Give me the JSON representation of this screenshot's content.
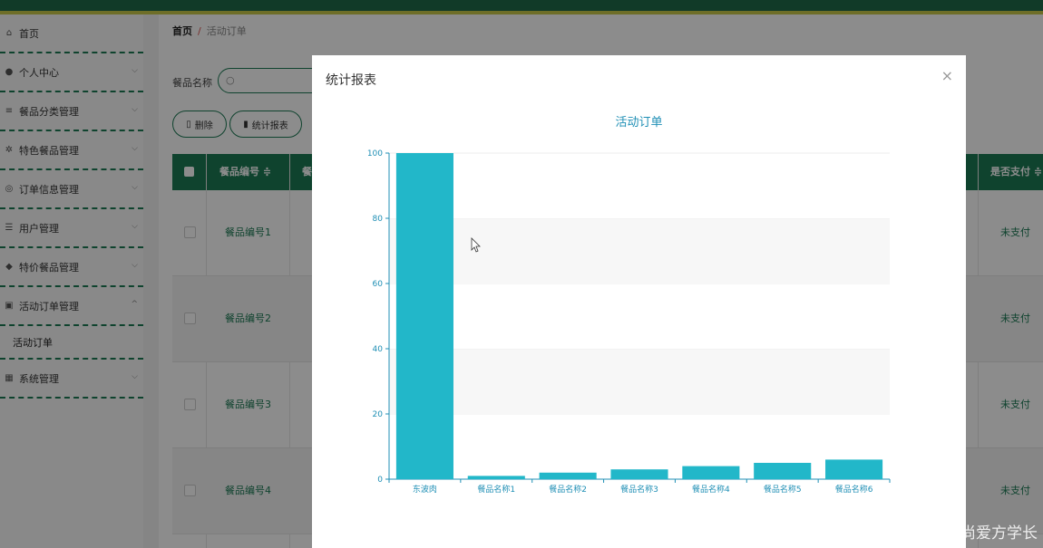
{
  "sidebar": {
    "items": [
      {
        "label": "首页",
        "icon": "home-icon",
        "glyph": "⌂",
        "chevron": ""
      },
      {
        "label": "个人中心",
        "icon": "user-icon",
        "glyph": "●",
        "chevron": "⌵"
      },
      {
        "label": "餐品分类管理",
        "icon": "sliders-icon",
        "glyph": "≡",
        "chevron": "⌵"
      },
      {
        "label": "特色餐品管理",
        "icon": "cog-icon",
        "glyph": "✲",
        "chevron": "⌵"
      },
      {
        "label": "订单信息管理",
        "icon": "globe-icon",
        "glyph": "◎",
        "chevron": "⌵"
      },
      {
        "label": "用户管理",
        "icon": "list-icon",
        "glyph": "☰",
        "chevron": "⌵"
      },
      {
        "label": "特价餐品管理",
        "icon": "tag-icon",
        "glyph": "◆",
        "chevron": "⌵"
      },
      {
        "label": "活动订单管理",
        "icon": "clipboard-icon",
        "glyph": "▣",
        "chevron": "^"
      }
    ],
    "sub_item": "活动订单",
    "last_item": {
      "label": "系统管理",
      "icon": "grid-icon",
      "glyph": "▦",
      "chevron": "⌵"
    }
  },
  "breadcrumb": {
    "home": "首页",
    "sep": "/",
    "current": "活动订单"
  },
  "search": {
    "label": "餐品名称",
    "icon": "search-icon"
  },
  "buttons": {
    "delete": "删除",
    "stats": "统计报表"
  },
  "table": {
    "headers": {
      "code": "餐品编号 ≑",
      "col2": "餐",
      "pay": "是否支付 ≑"
    },
    "rows": [
      {
        "code": "餐品编号1",
        "pay": "未支付"
      },
      {
        "code": "餐品编号2",
        "pay": "未支付"
      },
      {
        "code": "餐品编号3",
        "pay": "未支付"
      },
      {
        "code": "餐品编号4",
        "pay": "未支付"
      }
    ]
  },
  "modal": {
    "title": "统计报表",
    "close": "×"
  },
  "chart_data": {
    "type": "bar",
    "title": "活动订单",
    "categories": [
      "东波肉",
      "餐品名称1",
      "餐品名称2",
      "餐品名称3",
      "餐品名称4",
      "餐品名称5",
      "餐品名称6"
    ],
    "values": [
      100,
      1,
      2,
      3,
      4,
      5,
      6
    ],
    "ylim": [
      0,
      100
    ],
    "yticks": [
      0,
      20,
      40,
      60,
      80,
      100
    ],
    "xlabel": "",
    "ylabel": "",
    "grid": true,
    "bar_color": "#22b7c9",
    "axis_color": "#1f8fb5"
  },
  "watermark": "CSDN @尚爱方学长"
}
